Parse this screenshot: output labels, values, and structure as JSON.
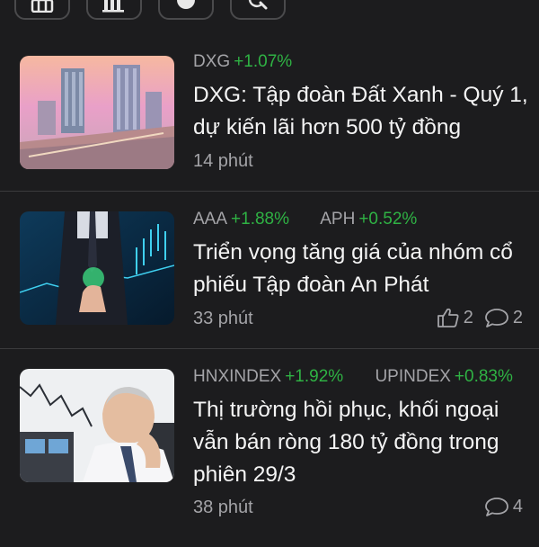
{
  "toolbar": {
    "buttons": [
      {
        "icon": "home-icon"
      },
      {
        "icon": "bar-chart-icon"
      },
      {
        "icon": "profile-icon"
      },
      {
        "icon": "search-icon"
      }
    ],
    "menu_icon": "more-vertical-icon"
  },
  "articles": [
    {
      "tags": [
        {
          "symbol": "DXG",
          "change": "+1.07%"
        }
      ],
      "title": "DXG: Tập đoàn Đất Xanh - Quý 1, dự kiến lãi hơn 500 tỷ đồng",
      "time": "14 phút",
      "likes": "",
      "comments": "",
      "thumbnail": "city-buildings-photo"
    },
    {
      "tags": [
        {
          "symbol": "AAA",
          "change": "+1.88%"
        },
        {
          "symbol": "APH",
          "change": "+0.52%"
        }
      ],
      "title": "Triển vọng tăng giá của nhóm cổ phiếu Tập đoàn An Phát",
      "time": "33 phút",
      "likes": "2",
      "comments": "2",
      "thumbnail": "businessman-stock-chart-photo"
    },
    {
      "tags": [
        {
          "symbol": "HNXINDEX",
          "change": "+1.92%"
        },
        {
          "symbol": "UPINDEX",
          "change": "+0.83%"
        }
      ],
      "title": "Thị trường hồi phục, khối ngoại vẫn bán ròng 180 tỷ đồng trong phiên 29/3",
      "time": "38 phút",
      "likes": "",
      "comments": "4",
      "thumbnail": "worried-trader-photo"
    }
  ],
  "colors": {
    "background": "#1c1c1e",
    "positive": "#2fb244",
    "muted": "#a4a4a8",
    "divider": "#3a3a3c"
  }
}
